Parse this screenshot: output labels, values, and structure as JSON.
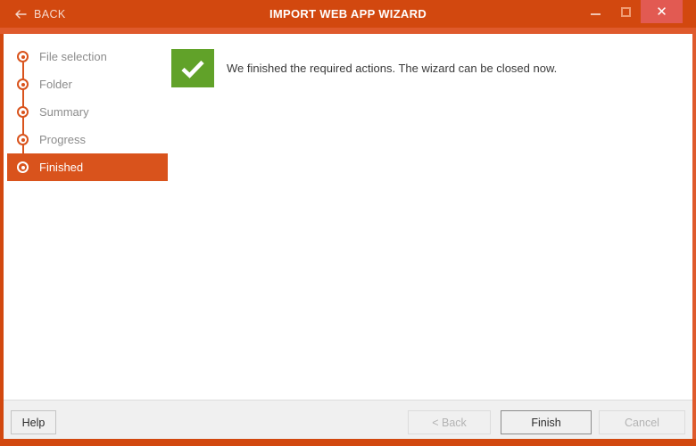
{
  "titlebar": {
    "back_label": "BACK",
    "back_icon": "arrow-left-icon",
    "title": "IMPORT WEB APP WIZARD",
    "minimize_icon": "minimize-icon",
    "maximize_icon": "maximize-icon",
    "close_icon": "close-icon",
    "close_glyph": "✕",
    "accent_color": "#d2480f",
    "close_color": "#e25a52"
  },
  "sidebar": {
    "steps": [
      {
        "label": "File selection",
        "active": false
      },
      {
        "label": "Folder",
        "active": false
      },
      {
        "label": "Summary",
        "active": false
      },
      {
        "label": "Progress",
        "active": false
      },
      {
        "label": "Finished",
        "active": true
      }
    ]
  },
  "main": {
    "status_icon": "check-mark-icon",
    "status_color": "#61a229",
    "message": "We finished the required actions. The wizard can be closed now."
  },
  "footer": {
    "help_label": "Help",
    "back_label": "< Back",
    "finish_label": "Finish",
    "cancel_label": "Cancel"
  }
}
